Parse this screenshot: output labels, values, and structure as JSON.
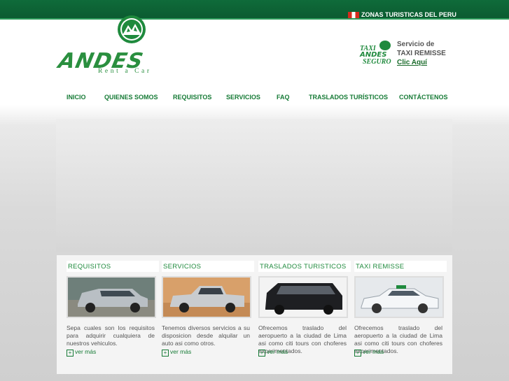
{
  "top": {
    "zonas": "ZONAS TURISTICAS DEL PERU",
    "flag_icon": "peru-flag-icon"
  },
  "logo": {
    "brand": "ANDES",
    "tagline": "Rent a Car",
    "icon": "andes-mountain-logo"
  },
  "taxi": {
    "line1": "TAXI",
    "line2": "ANDES",
    "line3": "SEGURO",
    "service_label": "Servicio de",
    "service_name": "TAXI REMISSE",
    "link": "Clic Aquí"
  },
  "nav": [
    {
      "label": "INICIO"
    },
    {
      "label": "QUIENES SOMOS"
    },
    {
      "label": "REQUISITOS"
    },
    {
      "label": "SERVICIOS"
    },
    {
      "label": "FAQ"
    },
    {
      "label": "TRASLADOS TURÍSTICOS"
    },
    {
      "label": "CONTÁCTENOS"
    }
  ],
  "cards": [
    {
      "title": "REQUISITOS",
      "image": "silver-suv-photo",
      "text": "Sepa cuales son los requisitos para adquirir cualquiera de nuestros vehiculos.",
      "more": "ver más"
    },
    {
      "title": "SERVICIOS",
      "image": "silver-pickup-truck-photo",
      "text": "Tenemos diversos servicios a su disposicion desde alquilar un auto asi como otros.",
      "more": "ver más"
    },
    {
      "title": "TRASLADOS TURISTICOS",
      "image": "black-van-photo",
      "text": "Ofrecemos traslado del aeropuerto a la ciudad de Lima asi como citi tours con choferes experimentados.",
      "more": "ver más"
    },
    {
      "title": "TAXI REMISSE",
      "image": "white-taxi-car-photo",
      "text": "Ofrecemos traslado del aeropuerto a la ciudad de Lima asi como citi tours con choferes experimentados.",
      "more": "ver más"
    }
  ],
  "colors": {
    "brand_green": "#1f8a3d",
    "top_bar": "#0f6b3a"
  }
}
